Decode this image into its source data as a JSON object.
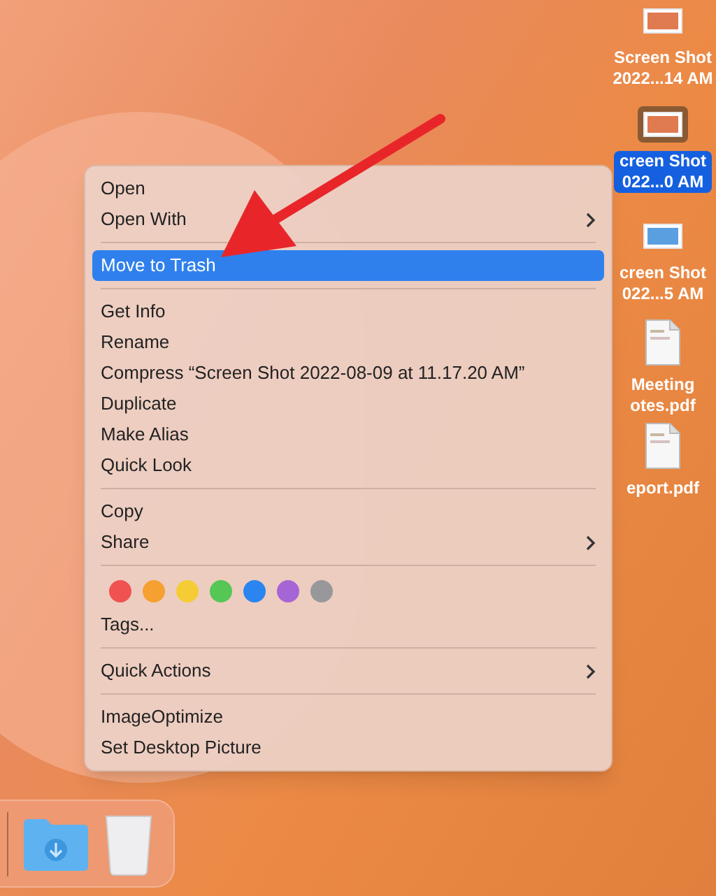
{
  "desktop_icons": [
    {
      "kind": "image",
      "lines": [
        "Screen Shot",
        "2022...14 AM"
      ],
      "selected": false
    },
    {
      "kind": "image",
      "lines": [
        "creen Shot",
        "022...0 AM"
      ],
      "selected": true
    },
    {
      "kind": "image",
      "lines": [
        "creen Shot",
        "022...5 AM"
      ],
      "selected": false
    },
    {
      "kind": "pdf",
      "lines": [
        "Meeting",
        "otes.pdf"
      ],
      "selected": false
    },
    {
      "kind": "pdf",
      "lines": [
        "eport.pdf"
      ],
      "selected": false
    }
  ],
  "context_menu": {
    "sections": [
      [
        {
          "kind": "item",
          "label": "Open",
          "selected": false,
          "submenu": false
        },
        {
          "kind": "item",
          "label": "Open With",
          "selected": false,
          "submenu": true
        }
      ],
      [
        {
          "kind": "item",
          "label": "Move to Trash",
          "selected": true,
          "submenu": false
        }
      ],
      [
        {
          "kind": "item",
          "label": "Get Info",
          "selected": false,
          "submenu": false
        },
        {
          "kind": "item",
          "label": "Rename",
          "selected": false,
          "submenu": false
        },
        {
          "kind": "item",
          "label": "Compress “Screen Shot 2022-08-09 at 11.17.20 AM”",
          "selected": false,
          "submenu": false
        },
        {
          "kind": "item",
          "label": "Duplicate",
          "selected": false,
          "submenu": false
        },
        {
          "kind": "item",
          "label": "Make Alias",
          "selected": false,
          "submenu": false
        },
        {
          "kind": "item",
          "label": "Quick Look",
          "selected": false,
          "submenu": false
        }
      ],
      [
        {
          "kind": "item",
          "label": "Copy",
          "selected": false,
          "submenu": false
        },
        {
          "kind": "item",
          "label": "Share",
          "selected": false,
          "submenu": true
        }
      ],
      [
        {
          "kind": "tags",
          "colors": [
            {
              "color": "#f05252"
            },
            {
              "color": "#f5a030"
            },
            {
              "color": "#f5cc35"
            },
            {
              "color": "#55c755"
            },
            {
              "color": "#2b85f0"
            },
            {
              "color": "#a665d5"
            },
            {
              "color": "#98989b"
            }
          ]
        },
        {
          "kind": "item",
          "label": "Tags...",
          "selected": false,
          "submenu": false
        }
      ],
      [
        {
          "kind": "item",
          "label": "Quick Actions",
          "selected": false,
          "submenu": true
        }
      ],
      [
        {
          "kind": "item",
          "label": "ImageOptimize",
          "selected": false,
          "submenu": false
        },
        {
          "kind": "item",
          "label": "Set Desktop Picture",
          "selected": false,
          "submenu": false
        }
      ]
    ]
  },
  "dock": {
    "items": [
      {
        "kind": "downloads"
      },
      {
        "kind": "trash"
      }
    ]
  }
}
